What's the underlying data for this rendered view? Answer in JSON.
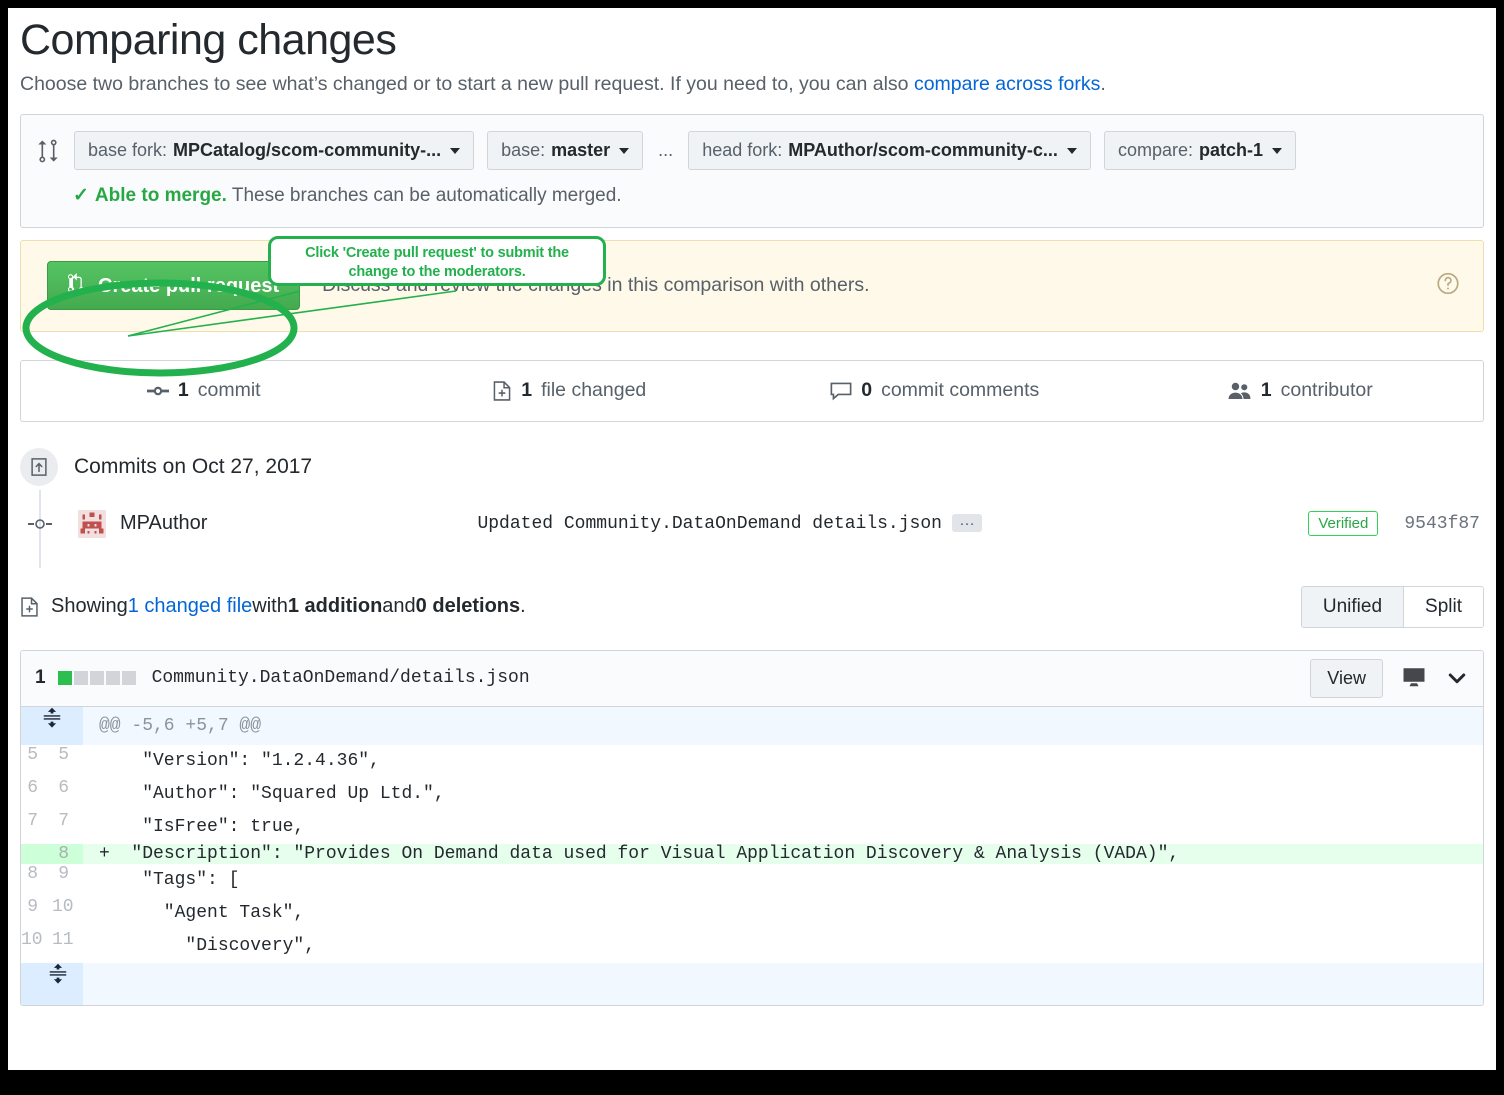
{
  "header": {
    "title": "Comparing changes",
    "subtitle_pre": "Choose two branches to see what’s changed or to start a new pull request. If you need to, you can also ",
    "subtitle_link": "compare across forks",
    "subtitle_post": "."
  },
  "branch_selector": {
    "base_fork_label": "base fork:",
    "base_fork_value": "MPCatalog/scom-community-...",
    "base_label": "base:",
    "base_value": "master",
    "separator": "...",
    "head_fork_label": "head fork:",
    "head_fork_value": "MPAuthor/scom-community-c...",
    "compare_label": "compare:",
    "compare_value": "patch-1",
    "merge_check": "✓",
    "merge_status_bold": "Able to merge.",
    "merge_status_text": " These branches can be automatically merged."
  },
  "pr_banner": {
    "button_label": "Create pull request",
    "description": "Discuss and review the changes in this comparison with others."
  },
  "annotation": {
    "callout_line1": "Click 'Create pull request' to submit the",
    "callout_line2": "change to the moderators.",
    "color": "#22b14c"
  },
  "stats": [
    {
      "icon": "commit-icon",
      "count": "1",
      "label": "commit"
    },
    {
      "icon": "file-diff-icon",
      "count": "1",
      "label": "file changed"
    },
    {
      "icon": "comment-icon",
      "count": "0",
      "label": "commit comments"
    },
    {
      "icon": "people-icon",
      "count": "1",
      "label": "contributor"
    }
  ],
  "commits": {
    "heading": "Commits on Oct 27, 2017",
    "rows": [
      {
        "author": "MPAuthor",
        "message": "Updated Community.DataOnDemand details.json",
        "expand_label": "…",
        "verified": "Verified",
        "sha": "9543f87"
      }
    ]
  },
  "showing": {
    "prefix": "Showing ",
    "changed_file": "1 changed file",
    "mid": " with ",
    "additions": "1 addition",
    "and": " and ",
    "deletions": "0 deletions",
    "suffix": ".",
    "view_unified": "Unified",
    "view_split": "Split"
  },
  "file": {
    "diffstat_count": "1",
    "blocks_added": 1,
    "blocks_total": 5,
    "name": "Community.DataOnDemand/details.json",
    "view_label": "View",
    "colors": {
      "added_block": "#2cbe4e",
      "neutral_block": "#d1d5da"
    }
  },
  "diff": {
    "hunk_header": "@@ -5,6 +5,7 @@",
    "lines": [
      {
        "type": "context",
        "old": "5",
        "new": "5",
        "marker": "",
        "code": "    \"Version\": \"1.2.4.36\","
      },
      {
        "type": "context",
        "old": "6",
        "new": "6",
        "marker": "",
        "code": "    \"Author\": \"Squared Up Ltd.\","
      },
      {
        "type": "context",
        "old": "7",
        "new": "7",
        "marker": "",
        "code": "    \"IsFree\": true,"
      },
      {
        "type": "add",
        "old": "",
        "new": "8",
        "marker": "+",
        "code": "  \"Description\": \"Provides On Demand data used for Visual Application Discovery & Analysis (VADA)\","
      },
      {
        "type": "context",
        "old": "8",
        "new": "9",
        "marker": "",
        "code": "    \"Tags\": ["
      },
      {
        "type": "context",
        "old": "9",
        "new": "10",
        "marker": "",
        "code": "      \"Agent Task\","
      },
      {
        "type": "context",
        "old": "10",
        "new": "11",
        "marker": "",
        "code": "        \"Discovery\","
      }
    ]
  }
}
